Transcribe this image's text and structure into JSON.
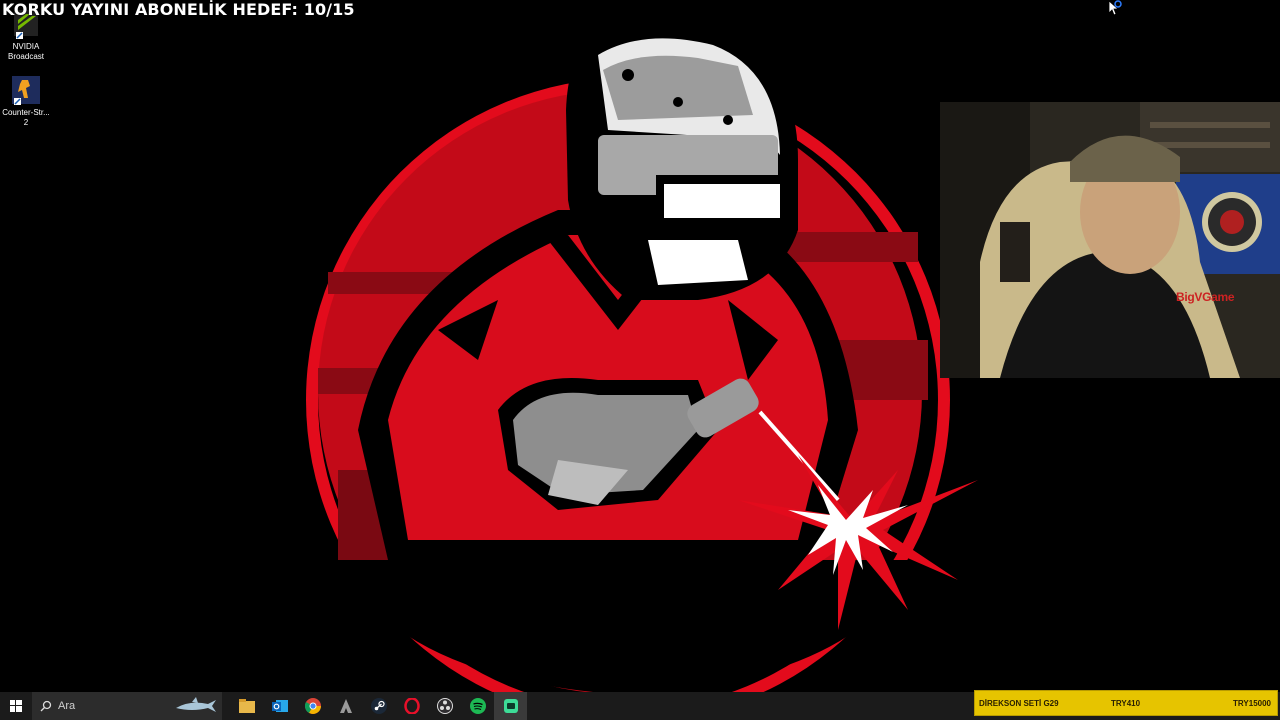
{
  "overlay": {
    "goal_text": "KORKU YAYINI ABONELİK HEDEF: 10/15"
  },
  "desktop_icons": [
    {
      "label": "NVIDIA Broadcast",
      "icon": "nvidia-broadcast-icon"
    },
    {
      "label": "Counter-Str... 2",
      "icon": "counter-strike-icon"
    }
  ],
  "webcam": {
    "watermark": "BigVGame"
  },
  "taskbar": {
    "search_placeholder": "Ara",
    "apps": [
      "file-explorer-icon",
      "outlook-icon",
      "chrome-icon",
      "app-icon",
      "steam-icon",
      "opera-gx-icon",
      "obs-icon",
      "spotify-icon",
      "app-icon-active"
    ]
  },
  "ticker": {
    "item": "DİREKSON SETİ G29",
    "current": "TRY410",
    "target": "TRY15000"
  },
  "colors": {
    "logo_red": "#e30b1c",
    "logo_dark_red": "#8a0a14",
    "ticker_bg": "#e6c400",
    "taskbar_bg": "#1b1b1b"
  }
}
